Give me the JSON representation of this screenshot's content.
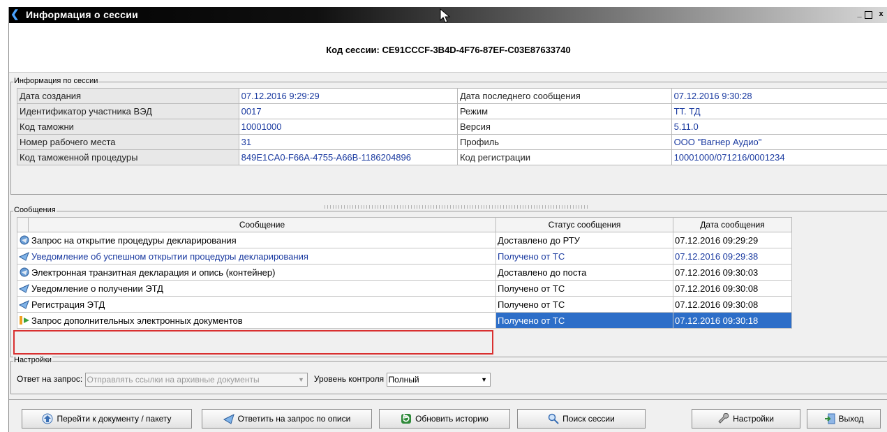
{
  "window": {
    "title": "Информация о сессии",
    "controls": [
      "_",
      "□",
      "x"
    ]
  },
  "session_code": "Код сессии: CE91CCCF-3B4D-4F76-87EF-C03E87633740",
  "info_group": {
    "legend": "Информация по сессии",
    "rows": [
      {
        "l1": "Дата создания",
        "v1": "07.12.2016 9:29:29",
        "l2": "Дата последнего сообщения",
        "v2": "07.12.2016 9:30:28"
      },
      {
        "l1": "Идентификатор участника ВЭД",
        "v1": "0017",
        "l2": "Режим",
        "v2": "ТТ. ТД"
      },
      {
        "l1": "Код таможни",
        "v1": "10001000",
        "l2": "Версия",
        "v2": "5.11.0"
      },
      {
        "l1": "Номер рабочего места",
        "v1": "31",
        "l2": "Профиль",
        "v2": "ООО \"Вагнер Аудио\""
      },
      {
        "l1": "Код таможенной процедуры",
        "v1": "849E1CA0-F66A-4755-A66B-1186204896",
        "l2": "Код регистрации",
        "v2": "10001000/071216/0001234"
      }
    ]
  },
  "messages_group": {
    "legend": "Сообщения",
    "headers": [
      "Сообщение",
      "Статус сообщения",
      "Дата сообщения"
    ],
    "rows": [
      {
        "icon": "send-icon",
        "message": "Запрос на открытие процедуры декларирования",
        "status": "Доставлено до РТУ",
        "date": "07.12.2016 09:29:29"
      },
      {
        "icon": "receive-icon",
        "message": "Уведомление об успешном открытии процедуры декларирования",
        "status": "Получено от ТС",
        "date": "07.12.2016 09:29:38"
      },
      {
        "icon": "send-icon",
        "message": "Электронная транзитная декларация и опись (контейнер)",
        "status": "Доставлено до поста",
        "date": "07.12.2016 09:30:03"
      },
      {
        "icon": "receive-icon",
        "message": "Уведомление о получении ЭТД",
        "status": "Получено от ТС",
        "date": "07.12.2016 09:30:08"
      },
      {
        "icon": "receive-icon",
        "message": "Регистрация ЭТД",
        "status": "Получено от ТС",
        "date": "07.12.2016 09:30:08"
      },
      {
        "icon": "warning-request-icon",
        "message": "Запрос дополнительных электронных документов",
        "status": "Получено от ТС",
        "date": "07.12.2016 09:30:18"
      }
    ]
  },
  "settings_group": {
    "legend": "Настройки",
    "reply_label": "Ответ на запрос:",
    "reply_value": "Отправлять ссылки на архивные документы",
    "control_label": "Уровень контроля",
    "control_value": "Полный"
  },
  "buttons": {
    "goto": "Перейти к документу / пакету",
    "reply": "Ответить на запрос по описи",
    "refresh": "Обновить историю",
    "search": "Поиск сессии",
    "settings": "Настройки",
    "exit": "Выход"
  },
  "colors": {
    "selection": "#2d6ec8",
    "value_text": "#1a3aa0",
    "highlight": "#d93030"
  }
}
